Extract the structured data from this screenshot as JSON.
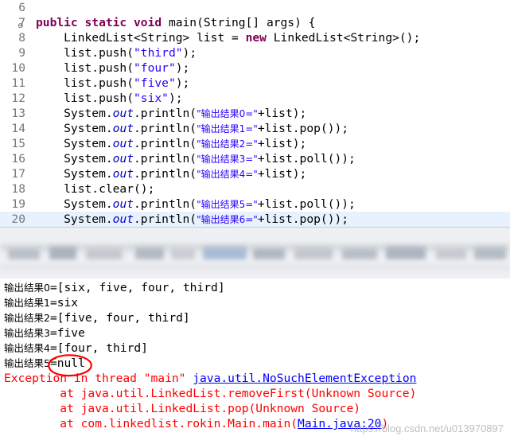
{
  "editor": {
    "lines": [
      {
        "n": "6",
        "parts": []
      },
      {
        "n": "7",
        "parts": [
          [
            "kw",
            "public static void "
          ],
          [
            "plain",
            "main(String[] args) {"
          ]
        ]
      },
      {
        "n": "8",
        "parts": [
          [
            "plain",
            "    LinkedList<String> list = "
          ],
          [
            "kw",
            "new "
          ],
          [
            "plain",
            "LinkedList<String>();"
          ]
        ]
      },
      {
        "n": "9",
        "parts": [
          [
            "plain",
            "    list.push("
          ],
          [
            "str",
            "\"third\""
          ],
          [
            "plain",
            ");"
          ]
        ]
      },
      {
        "n": "10",
        "parts": [
          [
            "plain",
            "    list.push("
          ],
          [
            "str",
            "\"four\""
          ],
          [
            "plain",
            ");"
          ]
        ]
      },
      {
        "n": "11",
        "parts": [
          [
            "plain",
            "    list.push("
          ],
          [
            "str",
            "\"five\""
          ],
          [
            "plain",
            ");"
          ]
        ]
      },
      {
        "n": "12",
        "parts": [
          [
            "plain",
            "    list.push("
          ],
          [
            "str",
            "\"six\""
          ],
          [
            "plain",
            ");"
          ]
        ]
      },
      {
        "n": "13",
        "parts": [
          [
            "plain",
            "    System."
          ],
          [
            "fld",
            "out"
          ],
          [
            "plain",
            ".println("
          ],
          [
            "cstr",
            "\"输出结果0=\""
          ],
          [
            "plain",
            "+list);"
          ]
        ]
      },
      {
        "n": "14",
        "parts": [
          [
            "plain",
            "    System."
          ],
          [
            "fld",
            "out"
          ],
          [
            "plain",
            ".println("
          ],
          [
            "cstr",
            "\"输出结果1=\""
          ],
          [
            "plain",
            "+list.pop());"
          ]
        ]
      },
      {
        "n": "15",
        "parts": [
          [
            "plain",
            "    System."
          ],
          [
            "fld",
            "out"
          ],
          [
            "plain",
            ".println("
          ],
          [
            "cstr",
            "\"输出结果2=\""
          ],
          [
            "plain",
            "+list);"
          ]
        ]
      },
      {
        "n": "16",
        "parts": [
          [
            "plain",
            "    System."
          ],
          [
            "fld",
            "out"
          ],
          [
            "plain",
            ".println("
          ],
          [
            "cstr",
            "\"输出结果3=\""
          ],
          [
            "plain",
            "+list.poll());"
          ]
        ]
      },
      {
        "n": "17",
        "parts": [
          [
            "plain",
            "    System."
          ],
          [
            "fld",
            "out"
          ],
          [
            "plain",
            ".println("
          ],
          [
            "cstr",
            "\"输出结果4=\""
          ],
          [
            "plain",
            "+list);"
          ]
        ]
      },
      {
        "n": "18",
        "parts": [
          [
            "plain",
            "    list.clear();"
          ]
        ]
      },
      {
        "n": "19",
        "parts": [
          [
            "plain",
            "    System."
          ],
          [
            "fld",
            "out"
          ],
          [
            "plain",
            ".println("
          ],
          [
            "cstr",
            "\"输出结果5=\""
          ],
          [
            "plain",
            "+list.poll());"
          ]
        ]
      },
      {
        "n": "20",
        "parts": [
          [
            "plain",
            "    System."
          ],
          [
            "fld",
            "out"
          ],
          [
            "plain",
            ".println("
          ],
          [
            "cstr",
            "\"输出结果6=\""
          ],
          [
            "plain",
            "+list.pop());"
          ]
        ]
      }
    ],
    "current_line": "20",
    "fold_marker": "⊖"
  },
  "console": {
    "outputs": [
      {
        "label": "输出结果0",
        "value": "=[six, five, four, third]"
      },
      {
        "label": "输出结果1",
        "value": "=six"
      },
      {
        "label": "输出结果2",
        "value": "=[five, four, third]"
      },
      {
        "label": "输出结果3",
        "value": "=five"
      },
      {
        "label": "输出结果4",
        "value": "=[four, third]"
      },
      {
        "label": "输出结果5",
        "value": "=null"
      }
    ],
    "exception_prefix": "Exception in thread \"main\" ",
    "exception_class": "java.util.NoSuchElementException",
    "stack": [
      {
        "text": "        at java.util.LinkedList.removeFirst(Unknown Source)"
      },
      {
        "text": "        at java.util.LinkedList.pop(Unknown Source)"
      },
      {
        "text_pre": "        at com.linkedlist.rokin.Main.main(",
        "link": "Main.java:20",
        "text_post": ")"
      }
    ]
  },
  "watermark": "https://blog.csdn.net/u013970897",
  "colors": {
    "keyword": "#7f0055",
    "string": "#2a00ff",
    "field": "#0000c0",
    "error": "#ff0000",
    "link": "#0000ff",
    "current_line": "#e8f2fe",
    "annotation": "#ff0000"
  }
}
